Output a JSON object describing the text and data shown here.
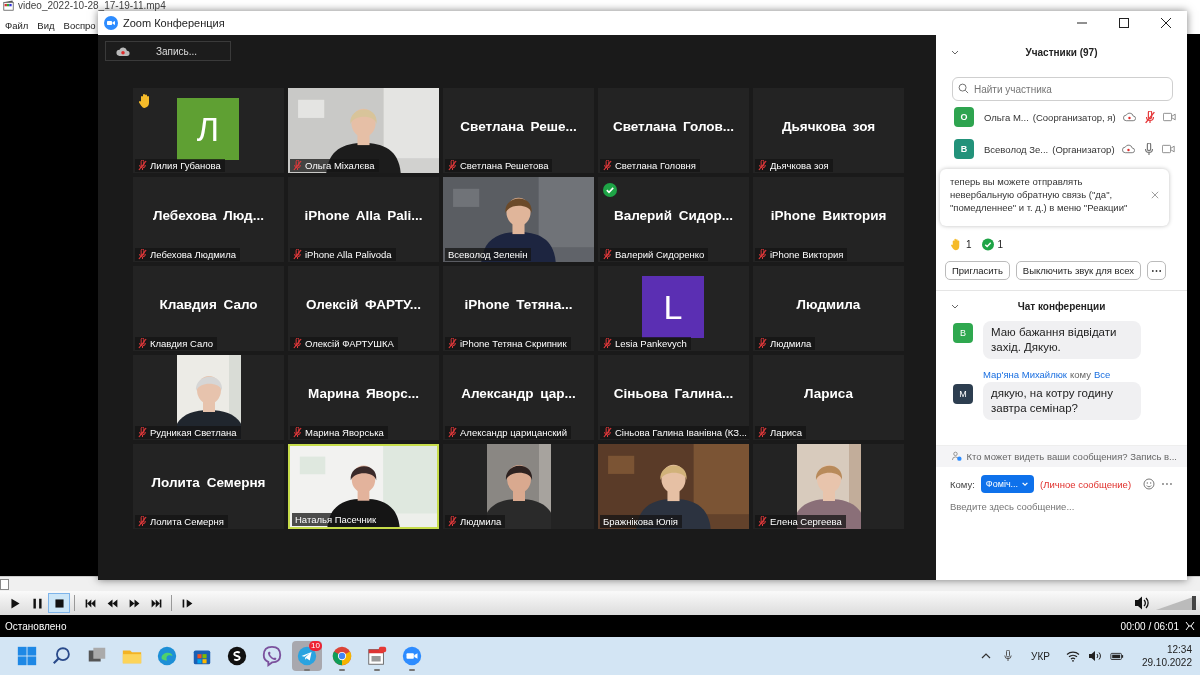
{
  "player": {
    "title": "video_2022-10-28_17-19-11.mp4",
    "menu": [
      "Файл",
      "Вид",
      "Воспро"
    ],
    "seek": {
      "level": 0
    },
    "buttons": [
      {
        "kind": "play",
        "selected": false
      },
      {
        "kind": "pause",
        "selected": false
      },
      {
        "kind": "stop",
        "selected": true
      },
      {
        "kind": "prev",
        "selected": false
      },
      {
        "kind": "rewind",
        "selected": false
      },
      {
        "kind": "forward",
        "selected": false
      },
      {
        "kind": "next",
        "selected": false
      },
      {
        "kind": "step",
        "selected": false
      }
    ],
    "volume": {
      "level": 0.95
    },
    "status": "Остановлено",
    "time": "00:00 / 06:01"
  },
  "zoom": {
    "title": "Zoom Конференция",
    "record_button": "Запись...",
    "tiles": [
      {
        "kind": "avatar",
        "letter": "Л",
        "color": "#5fa033",
        "label": "Лилия Губанова",
        "muted": true,
        "hand": true,
        "check": false,
        "speaking": false
      },
      {
        "kind": "video",
        "pillarbox": false,
        "label": "Ольга Міхалєва",
        "muted": true,
        "hand": false,
        "check": false,
        "speaking": false
      },
      {
        "kind": "name",
        "display": "Светлана Реше...",
        "label": "Светлана Решетова",
        "muted": true,
        "hand": false,
        "check": false,
        "speaking": false
      },
      {
        "kind": "name",
        "display": "Светлана Голов...",
        "label": "Светлана Головня",
        "muted": true,
        "hand": false,
        "check": false,
        "speaking": false
      },
      {
        "kind": "name",
        "display": "Дьячкова зоя",
        "label": "Дьячкова зоя",
        "muted": true,
        "hand": false,
        "check": false,
        "speaking": false
      },
      {
        "kind": "name",
        "display": "Лебехова Люд...",
        "label": "Лебехова Людмила",
        "muted": true,
        "hand": false,
        "check": false,
        "speaking": false
      },
      {
        "kind": "name",
        "display": "iPhone Alla Pali...",
        "label": "iPhone Alla Palivoda",
        "muted": true,
        "hand": false,
        "check": false,
        "speaking": false
      },
      {
        "kind": "video",
        "pillarbox": false,
        "label": "Всеволод Зеленін",
        "muted": false,
        "hand": false,
        "check": false,
        "speaking": false
      },
      {
        "kind": "name",
        "display": "Валерий Сидор...",
        "label": "Валерий Сидоренко",
        "muted": true,
        "hand": false,
        "check": true,
        "speaking": false
      },
      {
        "kind": "name",
        "display": "iPhone Виктория",
        "label": "iPhone Виктория",
        "muted": true,
        "hand": false,
        "check": false,
        "speaking": false
      },
      {
        "kind": "name",
        "display": "Клавдия Сало",
        "label": "Клавдия Сало",
        "muted": true,
        "hand": false,
        "check": false,
        "speaking": false
      },
      {
        "kind": "name",
        "display": "Олексій ФАРТУ...",
        "label": "Олексій ФАРТУШКА",
        "muted": true,
        "hand": false,
        "check": false,
        "speaking": false
      },
      {
        "kind": "name",
        "display": "iPhone Тетяна...",
        "label": "iPhone Тетяна Скрипник",
        "muted": true,
        "hand": false,
        "check": false,
        "speaking": false
      },
      {
        "kind": "avatar",
        "letter": "L",
        "color": "#5b2fb3",
        "label": "Lesia Pankevych",
        "muted": true,
        "hand": false,
        "check": false,
        "speaking": false
      },
      {
        "kind": "name",
        "display": "Людмила",
        "label": "Людмила",
        "muted": true,
        "hand": false,
        "check": false,
        "speaking": false
      },
      {
        "kind": "video",
        "pillarbox": true,
        "label": "Рудникая Светлана",
        "muted": true,
        "hand": false,
        "check": false,
        "speaking": false
      },
      {
        "kind": "name",
        "display": "Марина Яворс...",
        "label": "Марина Яворська",
        "muted": true,
        "hand": false,
        "check": false,
        "speaking": false
      },
      {
        "kind": "name",
        "display": "Александр цар...",
        "label": "Александр царицанский",
        "muted": true,
        "hand": false,
        "check": false,
        "speaking": false
      },
      {
        "kind": "name",
        "display": "Сіньова Галина...",
        "label": "Сіньова Галина Іванівна (КЗ...",
        "muted": true,
        "hand": false,
        "check": false,
        "speaking": false
      },
      {
        "kind": "name",
        "display": "Лариса",
        "label": "Лариса",
        "muted": true,
        "hand": false,
        "check": false,
        "speaking": false
      },
      {
        "kind": "name",
        "display": "Лолита Семерня",
        "label": "Лолита Семерня",
        "muted": true,
        "hand": false,
        "check": false,
        "speaking": false
      },
      {
        "kind": "video",
        "pillarbox": false,
        "label": "Наталья Пасечник",
        "muted": false,
        "hand": false,
        "check": false,
        "speaking": true
      },
      {
        "kind": "video",
        "pillarbox": true,
        "label": "Людмила",
        "muted": true,
        "hand": false,
        "check": false,
        "speaking": false
      },
      {
        "kind": "video",
        "pillarbox": false,
        "label": "Бражнікова Юлія",
        "muted": false,
        "hand": false,
        "check": false,
        "speaking": false
      },
      {
        "kind": "video",
        "pillarbox": true,
        "label": "Елена Сергеева",
        "muted": true,
        "hand": false,
        "check": false,
        "speaking": false
      }
    ],
    "participants": {
      "title": "Участники (97)",
      "search": {
        "placeholder": "Найти участника"
      },
      "rows": [
        {
          "letter": "О",
          "color": "#2ea44f",
          "name": "Ольга М...",
          "role": "(Соорганизатор, я)",
          "muted": true
        },
        {
          "letter": "В",
          "color": "#22927a",
          "name": "Всеволод Зе...",
          "role": "(Организатор)",
          "muted": false
        }
      ],
      "notice": "теперь вы можете отправлять невербальную обратную связь (\"да\", \"помедленнее\" и т. д.) в меню \"Реакции\"",
      "reactions": [
        {
          "kind": "hand",
          "count": "1"
        },
        {
          "kind": "check",
          "count": "1"
        }
      ],
      "buttons": [
        "Пригласить",
        "Выключить звук для всех"
      ]
    },
    "chat": {
      "title": "Чат конференции",
      "messages": [
        {
          "letter": "В",
          "color": "#2fa84f",
          "text": "Маю бажання відвідати захід. Дякую."
        },
        {
          "letter": "М",
          "color": "#2d3e50",
          "sender": "Мар'яна Михайлюк",
          "to_word": "кому",
          "recipient": "Все",
          "text": "дякую, на котру годину завтра семінар?"
        }
      ],
      "info": "Кто может видеть ваши сообщения? Запись в...",
      "to_label": "Кому:",
      "to_value": "Фоміч...",
      "private": "(Личное сообщение)",
      "input": {
        "placeholder": "Введите здесь сообщение..."
      }
    }
  },
  "taskbar": {
    "apps": [
      {
        "kind": "start",
        "running": false,
        "active": false
      },
      {
        "kind": "search",
        "running": false,
        "active": false
      },
      {
        "kind": "taskview",
        "running": false,
        "active": false
      },
      {
        "kind": "folder",
        "running": false,
        "active": false
      },
      {
        "kind": "edge",
        "running": false,
        "active": false
      },
      {
        "kind": "store",
        "running": false,
        "active": false
      },
      {
        "kind": "skype",
        "running": false,
        "active": false
      },
      {
        "kind": "viber",
        "running": false,
        "active": false
      },
      {
        "kind": "telegram",
        "running": true,
        "active": true,
        "badge": "10"
      },
      {
        "kind": "chrome",
        "running": true,
        "active": false
      },
      {
        "kind": "calendar",
        "running": true,
        "active": false
      },
      {
        "kind": "zoom",
        "running": true,
        "active": false
      }
    ],
    "language": "УКР",
    "time": "12:34",
    "date": "29.10.2022"
  }
}
